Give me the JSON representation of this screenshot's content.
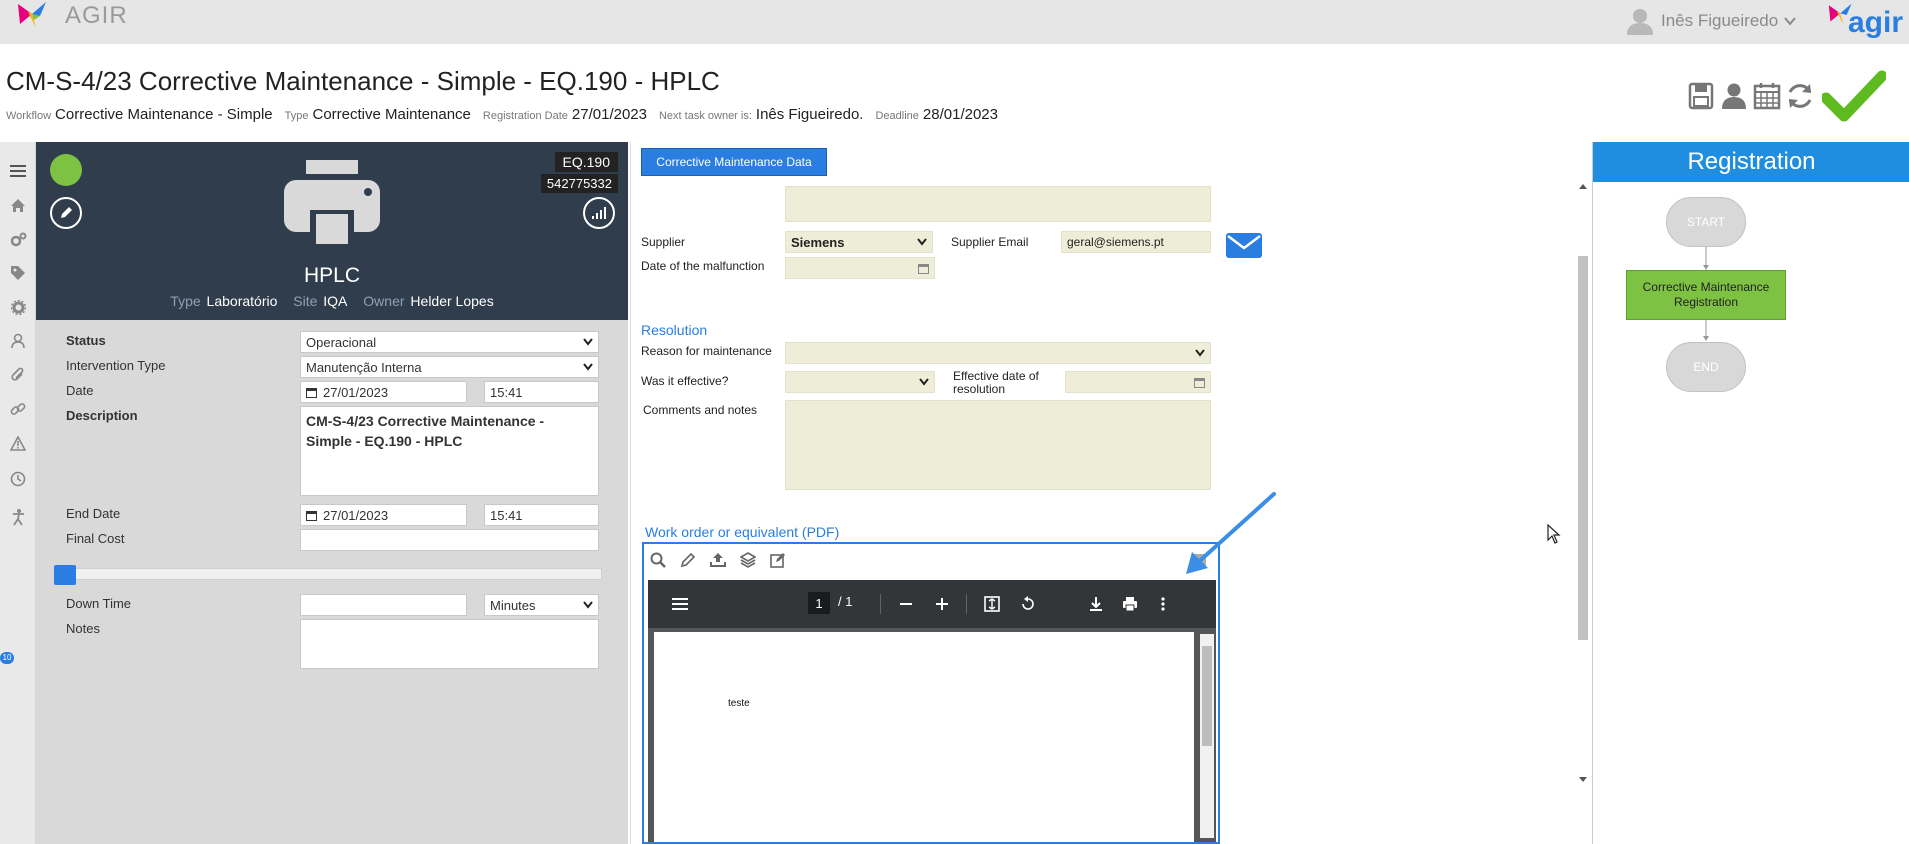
{
  "topbar": {
    "app_name": "AGIR",
    "user_name": "Inês Figueiredo",
    "brand": "agir"
  },
  "header": {
    "title": "CM-S-4/23 Corrective Maintenance - Simple - EQ.190 - HPLC",
    "meta": [
      {
        "label": "Workflow",
        "value": "Corrective Maintenance - Simple"
      },
      {
        "label": "Type",
        "value": "Corrective Maintenance"
      },
      {
        "label": "Registration Date",
        "value": "27/01/2023"
      },
      {
        "label": "Next task owner is:",
        "value": "Inês Figueiredo."
      },
      {
        "label": "Deadline",
        "value": "28/01/2023"
      }
    ],
    "actions": [
      "save-icon",
      "user-icon",
      "calendar-icon",
      "refresh-icon",
      "checkmark-icon"
    ]
  },
  "nav": {
    "items": [
      "menu-icon",
      "home-icon",
      "gears-icon",
      "tag-icon",
      "settings-icon",
      "contacts-icon",
      "attachment-icon",
      "link-icon",
      "warning-icon",
      "clock-icon",
      "accessibility-icon"
    ],
    "badge": "10"
  },
  "equipment": {
    "code": "EQ.190",
    "serial": "542775332",
    "name": "HPLC",
    "type_label": "Type",
    "type_value": "Laboratório",
    "site_label": "Site",
    "site_value": "IQA",
    "owner_label": "Owner",
    "owner_value": "Helder Lopes",
    "status_color": "#7dc242"
  },
  "form": {
    "status_label": "Status",
    "status_value": "Operacional",
    "intervention_label": "Intervention Type",
    "intervention_value": "Manutenção Interna",
    "date_label": "Date",
    "date_value": "27/01/2023",
    "time_value": "15:41",
    "description_label": "Description",
    "description_value": "CM-S-4/23 Corrective Maintenance - Simple - EQ.190 - HPLC",
    "end_date_label": "End Date",
    "end_date_value": "27/01/2023",
    "end_time_value": "15:41",
    "final_cost_label": "Final Cost",
    "final_cost_value": "",
    "slider_value": 0,
    "down_time_label": "Down Time",
    "down_time_value": "",
    "down_time_unit": "Minutes",
    "notes_label": "Notes",
    "notes_value": ""
  },
  "cm_data": {
    "tab_label": "Corrective Maintenance Data",
    "supplier_label": "Supplier",
    "supplier_value": "Siemens",
    "supplier_email_label": "Supplier Email",
    "supplier_email_value": "geral@siemens.pt",
    "malfunction_date_label": "Date of the malfunction",
    "malfunction_date_value": "",
    "resolution_section": "Resolution",
    "reason_label": "Reason for maintenance",
    "reason_value": "",
    "effective_label": "Was it effective?",
    "effective_value": "",
    "effective_date_label": "Effective date of resolution",
    "effective_date_value": "",
    "comments_label": "Comments and notes",
    "comments_value": "",
    "work_order_section": "Work order or equivalent (PDF)"
  },
  "pdf": {
    "page_current": "1",
    "page_total": "/ 1",
    "content_text": "teste"
  },
  "workflow": {
    "title": "Registration",
    "start_label": "START",
    "step_label": "Corrective Maintenance Registration",
    "end_label": "END",
    "active_color": "#7dc242"
  },
  "colors": {
    "accent": "#2a7de1",
    "header_blue": "#1f8ee0",
    "card_bg": "#2f3d4c",
    "field_bg": "#eeeed8"
  }
}
